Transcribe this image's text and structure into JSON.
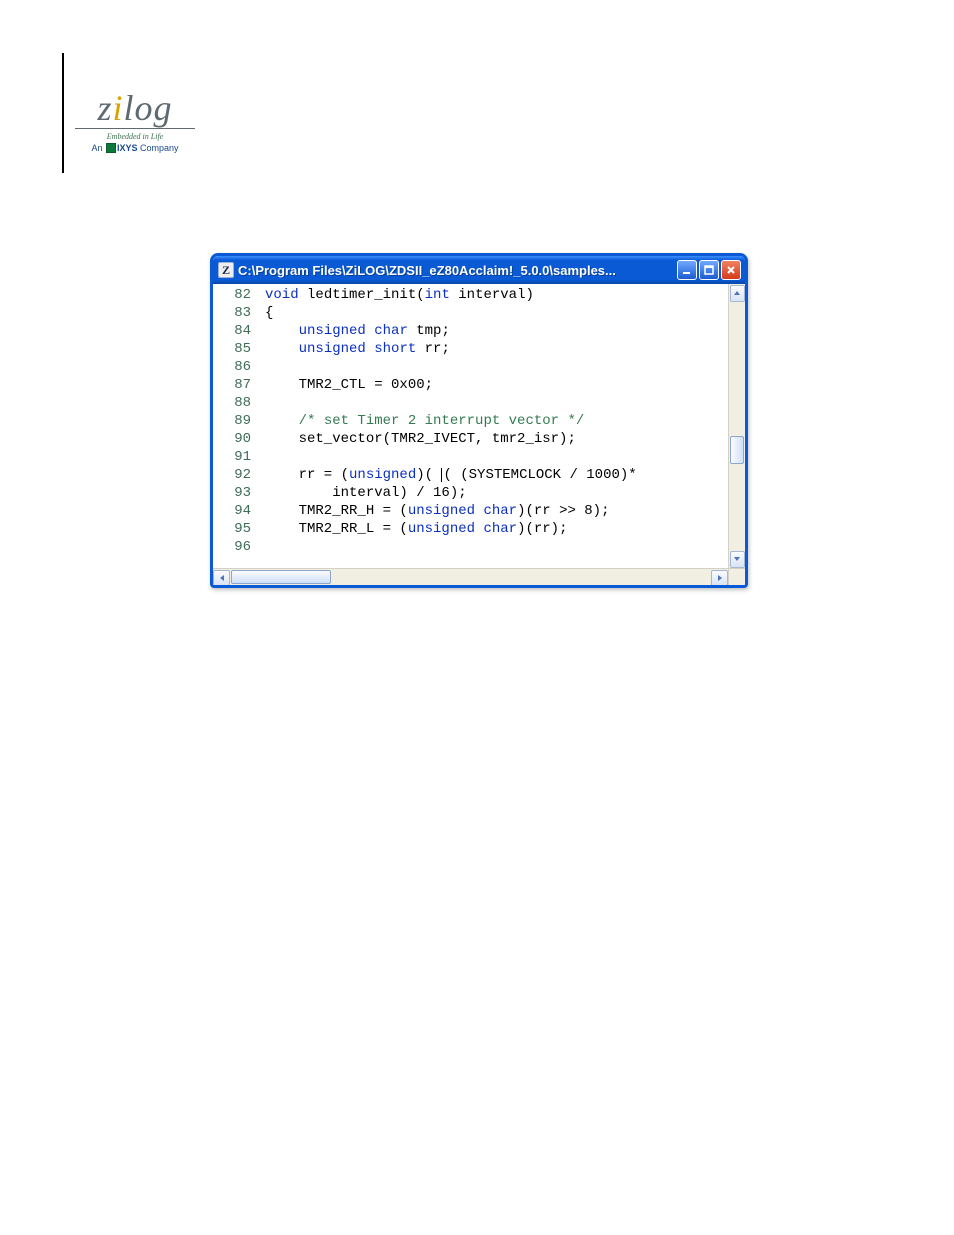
{
  "logo": {
    "brand": "zilog",
    "tag1": "Embedded in Life",
    "tag2_an": "An",
    "tag2_ixys": "IXYS",
    "tag2_comp": "Company"
  },
  "window": {
    "title": "C:\\Program Files\\ZiLOG\\ZDSII_eZ80Acclaim!_5.0.0\\samples...",
    "app_icon_letter": "Z"
  },
  "code": {
    "lines": [
      {
        "num": 82,
        "tokens": [
          {
            "t": "kw",
            "v": "void"
          },
          {
            "t": "src",
            "v": " ledtimer_init("
          },
          {
            "t": "kw",
            "v": "int"
          },
          {
            "t": "src",
            "v": " interval)"
          }
        ]
      },
      {
        "num": 83,
        "tokens": [
          {
            "t": "src",
            "v": "{"
          }
        ]
      },
      {
        "num": 84,
        "tokens": [
          {
            "t": "src",
            "v": "    "
          },
          {
            "t": "kw",
            "v": "unsigned"
          },
          {
            "t": "src",
            "v": " "
          },
          {
            "t": "kw",
            "v": "char"
          },
          {
            "t": "src",
            "v": " tmp;"
          }
        ]
      },
      {
        "num": 85,
        "tokens": [
          {
            "t": "src",
            "v": "    "
          },
          {
            "t": "kw",
            "v": "unsigned"
          },
          {
            "t": "src",
            "v": " "
          },
          {
            "t": "kw",
            "v": "short"
          },
          {
            "t": "src",
            "v": " rr;"
          }
        ]
      },
      {
        "num": 86,
        "tokens": []
      },
      {
        "num": 87,
        "tokens": [
          {
            "t": "src",
            "v": "    TMR2_CTL = 0x00;"
          }
        ]
      },
      {
        "num": 88,
        "tokens": []
      },
      {
        "num": 89,
        "tokens": [
          {
            "t": "src",
            "v": "    "
          },
          {
            "t": "cmt",
            "v": "/* set Timer 2 interrupt vector */"
          }
        ]
      },
      {
        "num": 90,
        "tokens": [
          {
            "t": "src",
            "v": "    set_vector(TMR2_IVECT, tmr2_isr);"
          }
        ]
      },
      {
        "num": 91,
        "tokens": []
      },
      {
        "num": 92,
        "tokens": [
          {
            "t": "src",
            "v": "    rr = ("
          },
          {
            "t": "kw",
            "v": "unsigned"
          },
          {
            "t": "src",
            "v": ")( "
          },
          {
            "t": "caret",
            "v": ""
          },
          {
            "t": "src",
            "v": "( (SYSTEMCLOCK / 1000)*"
          }
        ]
      },
      {
        "num": 93,
        "tokens": [
          {
            "t": "src",
            "v": "        interval) / 16);"
          }
        ]
      },
      {
        "num": 94,
        "tokens": [
          {
            "t": "src",
            "v": "    TMR2_RR_H = ("
          },
          {
            "t": "kw",
            "v": "unsigned"
          },
          {
            "t": "src",
            "v": " "
          },
          {
            "t": "kw",
            "v": "char"
          },
          {
            "t": "src",
            "v": ")(rr >> 8);"
          }
        ]
      },
      {
        "num": 95,
        "tokens": [
          {
            "t": "src",
            "v": "    TMR2_RR_L = ("
          },
          {
            "t": "kw",
            "v": "unsigned"
          },
          {
            "t": "src",
            "v": " "
          },
          {
            "t": "kw",
            "v": "char"
          },
          {
            "t": "src",
            "v": ")(rr);"
          }
        ]
      },
      {
        "num": 96,
        "tokens": []
      }
    ]
  }
}
